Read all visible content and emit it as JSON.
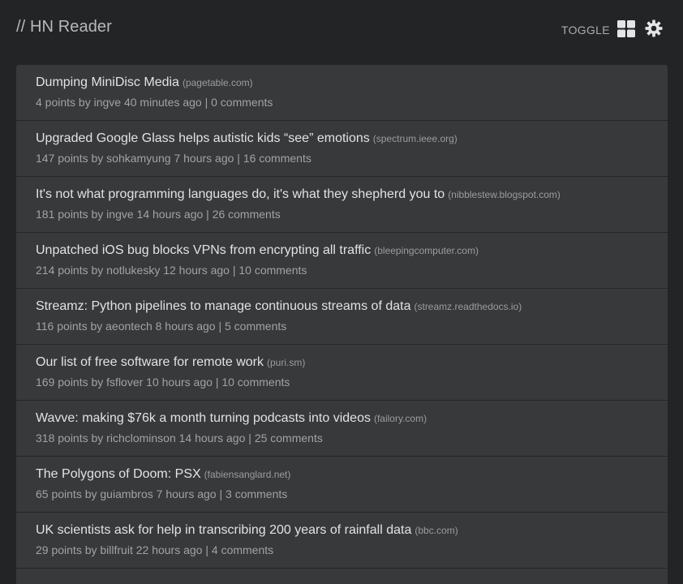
{
  "header": {
    "title": "// HN Reader",
    "toggle_label": "TOGGLE",
    "layout_icon": "grid-icon",
    "settings_icon": "gear-icon"
  },
  "colors": {
    "background": "#232425",
    "card": "#37393b",
    "title_text": "#e0e2e3",
    "meta_text": "#a0a3a5"
  },
  "stories": [
    {
      "title": "Dumping MiniDisc Media",
      "domain": "(pagetable.com)",
      "meta": "4 points by ingve 40 minutes ago",
      "separator": "|",
      "comments": "0 comments"
    },
    {
      "title": "Upgraded Google Glass helps autistic kids “see” emotions",
      "domain": "(spectrum.ieee.org)",
      "meta": "147 points by sohkamyung 7 hours ago",
      "separator": "|",
      "comments": "16 comments"
    },
    {
      "title": "It's not what programming languages do, it's what they shepherd you to",
      "domain": "(nibblestew.blogspot.com)",
      "meta": "181 points by ingve 14 hours ago",
      "separator": "|",
      "comments": "26 comments"
    },
    {
      "title": "Unpatched iOS bug blocks VPNs from encrypting all traffic",
      "domain": "(bleepingcomputer.com)",
      "meta": "214 points by notlukesky 12 hours ago",
      "separator": "|",
      "comments": "10 comments"
    },
    {
      "title": "Streamz: Python pipelines to manage continuous streams of data",
      "domain": "(streamz.readthedocs.io)",
      "meta": "116 points by aeontech 8 hours ago",
      "separator": "|",
      "comments": "5 comments"
    },
    {
      "title": "Our list of free software for remote work",
      "domain": "(puri.sm)",
      "meta": "169 points by fsflover 10 hours ago",
      "separator": "|",
      "comments": "10 comments"
    },
    {
      "title": "Wavve: making $76k a month turning podcasts into videos",
      "domain": "(failory.com)",
      "meta": "318 points by richclominson 14 hours ago",
      "separator": "|",
      "comments": "25 comments"
    },
    {
      "title": "The Polygons of Doom: PSX",
      "domain": "(fabiensanglard.net)",
      "meta": "65 points by guiambros 7 hours ago",
      "separator": "|",
      "comments": "3 comments"
    },
    {
      "title": "UK scientists ask for help in transcribing 200 years of rainfall data",
      "domain": "(bbc.com)",
      "meta": "29 points by billfruit 22 hours ago",
      "separator": "|",
      "comments": "4 comments"
    }
  ]
}
